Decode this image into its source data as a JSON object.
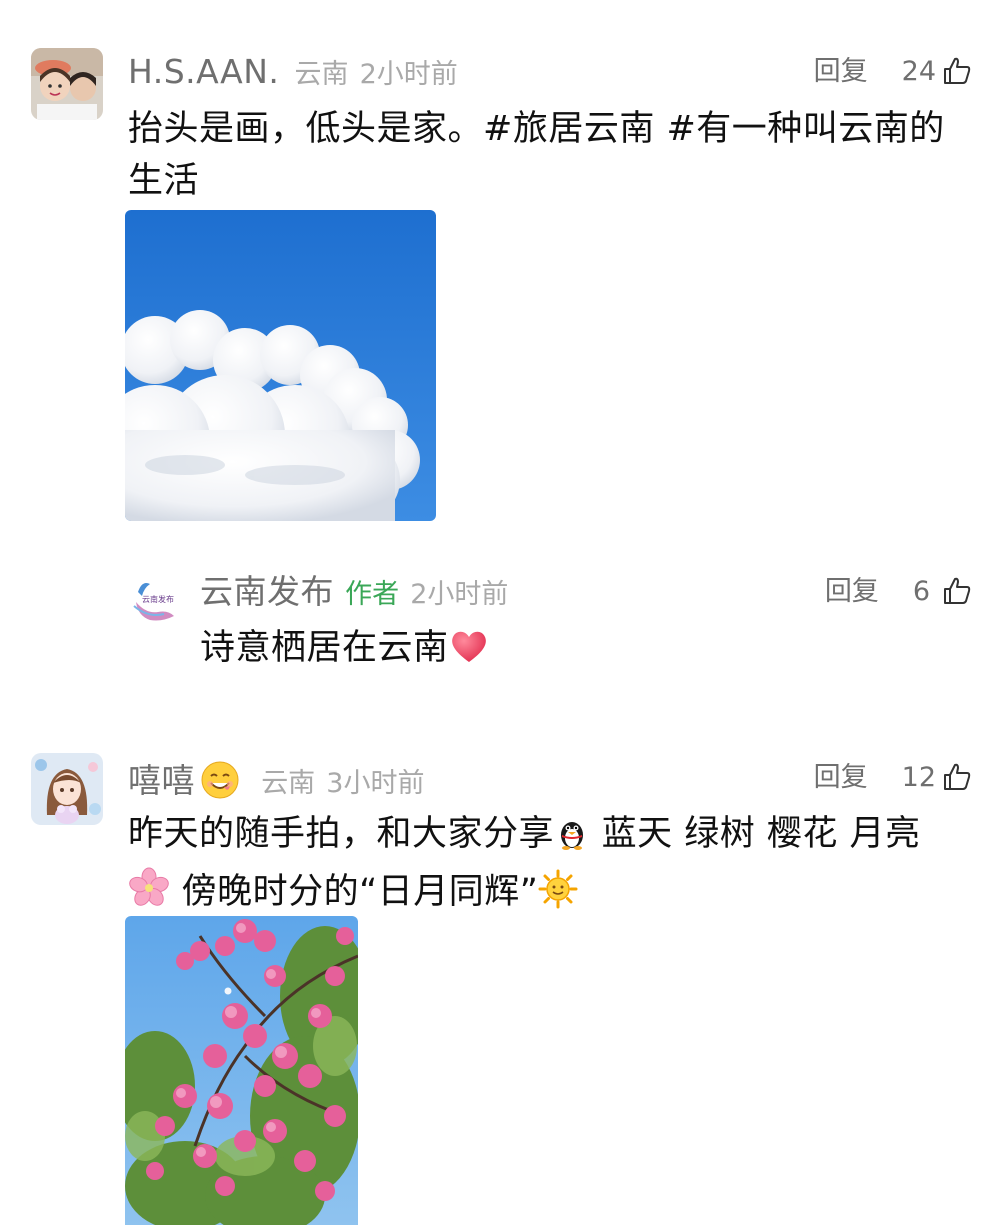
{
  "comments": [
    {
      "user": "H.S.AAN.",
      "location": "云南",
      "time": "2小时前",
      "reply": "回复",
      "likes": "24",
      "text_line1": "抬头是画，低头是家。#旅居云南 #有一种叫云南的",
      "text_line2": "生活",
      "avatar_icon": "couple-photo-avatar",
      "image": "blue-sky-clouds-photo"
    },
    {
      "user": "云南发布",
      "author_tag": "作者",
      "time": "2小时前",
      "reply": "回复",
      "likes": "6",
      "text": "诗意栖居在云南",
      "avatar_text": "云南发布",
      "avatar_icon": "peacock-logo-avatar",
      "emoji": "red-heart-icon"
    },
    {
      "user": "嘻嘻",
      "location": "云南",
      "time": "3小时前",
      "reply": "回复",
      "likes": "12",
      "text_part1": "昨天的随手拍，和大家分享",
      "text_part2": " 蓝天 绿树 樱花 月亮",
      "text_part3": " 傍晚时分的“日月同辉”",
      "avatar_icon": "anime-girl-avatar",
      "name_emoji": "smiling-face-icon",
      "emojis": [
        "penguin-icon",
        "cherry-blossom-icon",
        "sun-face-icon"
      ],
      "image": "cherry-blossom-tree-photo"
    }
  ],
  "colors": {
    "name": "#6f6f6f",
    "meta": "#a9a9a9",
    "author_tag": "#3aa757",
    "text": "#111111"
  }
}
